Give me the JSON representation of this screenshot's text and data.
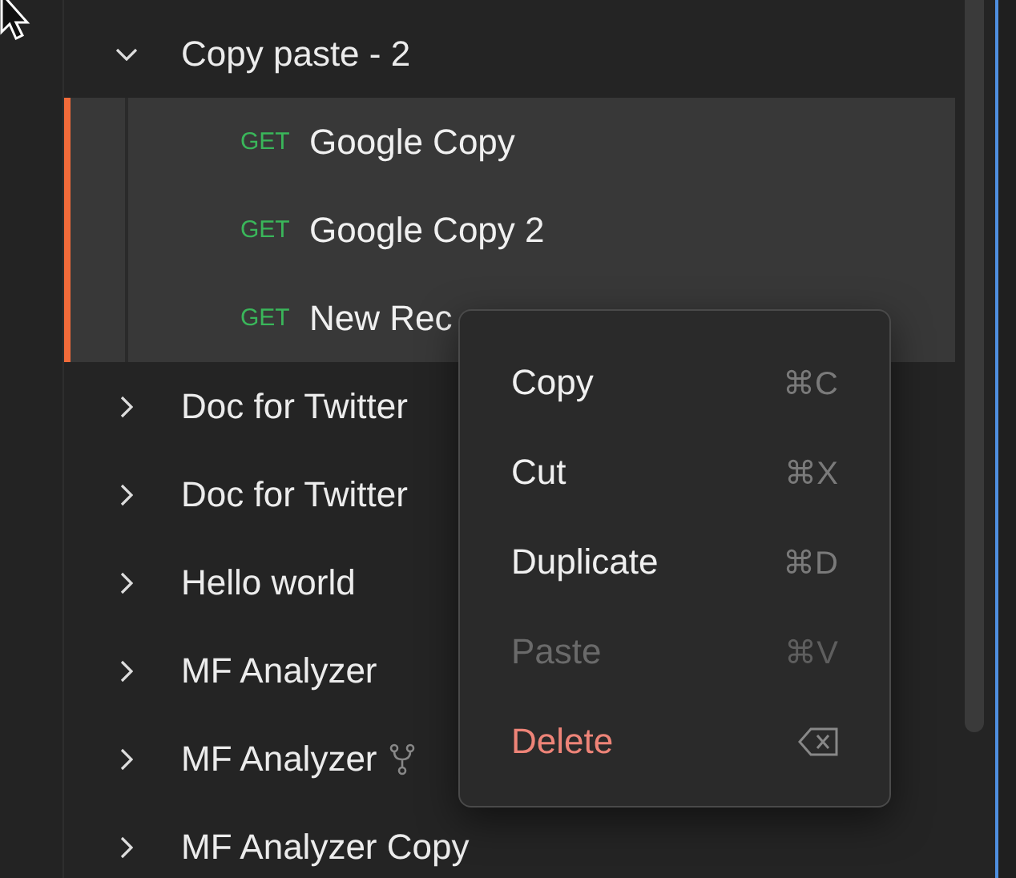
{
  "tree": [
    {
      "name": "Copy paste - 2",
      "expanded": true,
      "forked": false,
      "children": [
        {
          "method": "GET",
          "name": "Google Copy",
          "selected": true
        },
        {
          "method": "GET",
          "name": "Google Copy 2",
          "selected": true
        },
        {
          "method": "GET",
          "name": "New Rec",
          "selected": true
        }
      ]
    },
    {
      "name": "Doc for Twitter",
      "expanded": false,
      "forked": false
    },
    {
      "name": "Doc for Twitter",
      "expanded": false,
      "forked": false
    },
    {
      "name": "Hello world",
      "expanded": false,
      "forked": false
    },
    {
      "name": "MF Analyzer",
      "expanded": false,
      "forked": false
    },
    {
      "name": "MF Analyzer",
      "expanded": false,
      "forked": true
    },
    {
      "name": "MF Analyzer Copy",
      "expanded": false,
      "forked": false
    }
  ],
  "context_menu": {
    "items": [
      {
        "kind": "normal",
        "label": "Copy",
        "shortcut": "⌘C",
        "disabled": false
      },
      {
        "kind": "normal",
        "label": "Cut",
        "shortcut": "⌘X",
        "disabled": false
      },
      {
        "kind": "normal",
        "label": "Duplicate",
        "shortcut": "⌘D",
        "disabled": false
      },
      {
        "kind": "normal",
        "label": "Paste",
        "shortcut": "⌘V",
        "disabled": true
      },
      {
        "kind": "danger",
        "label": "Delete",
        "disabled": false
      }
    ]
  }
}
